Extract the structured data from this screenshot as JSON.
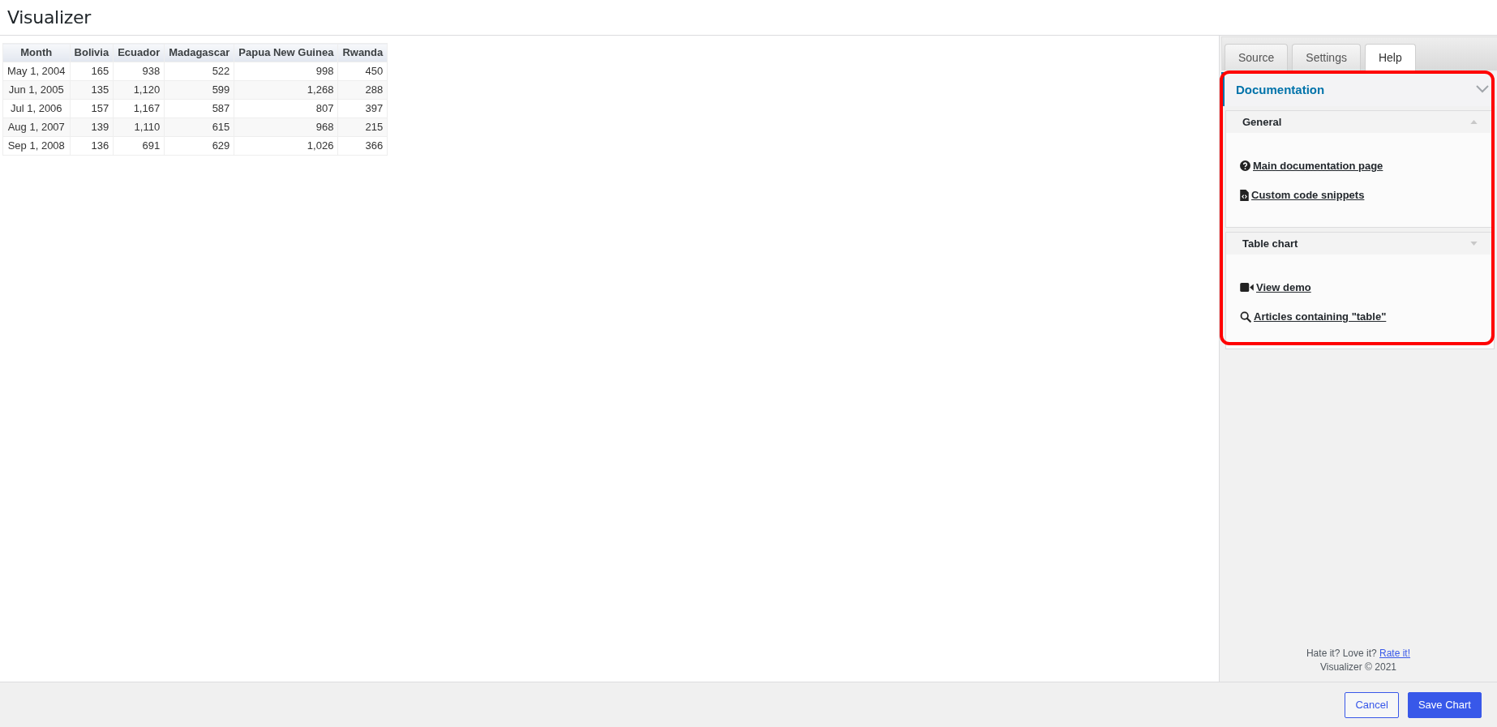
{
  "window": {
    "title": "Visualizer"
  },
  "table": {
    "columns": [
      "Month",
      "Bolivia",
      "Ecuador",
      "Madagascar",
      "Papua New Guinea",
      "Rwanda"
    ],
    "rows": [
      [
        "May 1, 2004",
        "165",
        "938",
        "522",
        "998",
        "450"
      ],
      [
        "Jun 1, 2005",
        "135",
        "1,120",
        "599",
        "1,268",
        "288"
      ],
      [
        "Jul 1, 2006",
        "157",
        "1,167",
        "587",
        "807",
        "397"
      ],
      [
        "Aug 1, 2007",
        "139",
        "1,110",
        "615",
        "968",
        "215"
      ],
      [
        "Sep 1, 2008",
        "136",
        "691",
        "629",
        "1,026",
        "366"
      ]
    ]
  },
  "sidebar": {
    "tabs": [
      {
        "label": "Source",
        "selected": false
      },
      {
        "label": "Settings",
        "selected": false
      },
      {
        "label": "Help",
        "selected": true
      }
    ],
    "panel": {
      "title": "Documentation",
      "expanded": true,
      "highlighted": true,
      "sections": [
        {
          "title": "General",
          "expanded": true,
          "links": [
            {
              "kind": "documentation",
              "label": "Main documentation page"
            },
            {
              "kind": "snippets",
              "label": "Custom code snippets"
            }
          ]
        },
        {
          "title": "Table chart",
          "expanded": false,
          "links": [
            {
              "kind": "demo",
              "label": "View demo"
            },
            {
              "kind": "articles",
              "label": "Articles containing \"table\""
            }
          ]
        }
      ]
    },
    "footer": {
      "feedback": "Hate it? Love it?",
      "rate_link": "Rate it!",
      "copyright": "Visualizer © 2021"
    }
  },
  "actions": [
    {
      "kind": "secondary",
      "label": "Cancel"
    },
    {
      "kind": "primary",
      "label": "Save Chart"
    }
  ]
}
